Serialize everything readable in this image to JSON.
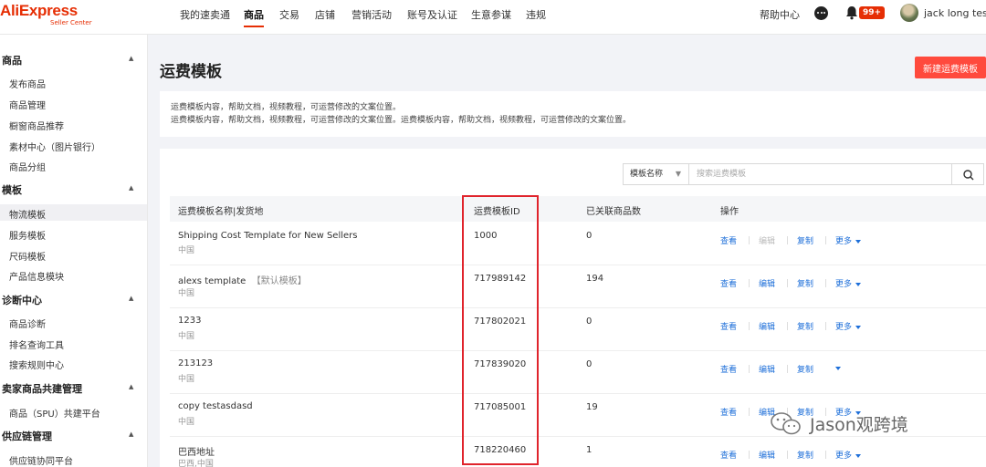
{
  "brand": {
    "logo_text": "AliExpress",
    "logo_sub": "Seller Center",
    "accent": "#e62e04"
  },
  "topnav": {
    "items": [
      "我的速卖通",
      "商品",
      "交易",
      "店铺",
      "营销活动",
      "账号及认证",
      "生意参谋",
      "违规"
    ],
    "active": "商品"
  },
  "header_right": {
    "help": "帮助中心",
    "badge": "99+",
    "user": "jack long test"
  },
  "sidebar": {
    "groups": [
      {
        "title": "商品",
        "items": [
          "发布商品",
          "商品管理",
          "橱窗商品推荐",
          "素材中心（图片银行）",
          "商品分组"
        ]
      },
      {
        "title": "模板",
        "items": [
          "物流模板",
          "服务模板",
          "尺码模板",
          "产品信息模块"
        ]
      },
      {
        "title": "诊断中心",
        "items": [
          "商品诊断",
          "排名查询工具",
          "搜索规则中心"
        ]
      },
      {
        "title": "卖家商品共建管理",
        "items": [
          "商品（SPU）共建平台"
        ]
      },
      {
        "title": "供应链管理",
        "items": [
          "供应链协同平台"
        ]
      }
    ],
    "active_item": "物流模板"
  },
  "page": {
    "title": "运费模板",
    "new_button": "新建运费模板",
    "notice_lines": [
      "运费模板内容，帮助文档，视频教程，可运营修改的文案位置。",
      "运费模板内容，帮助文档，视频教程，可运营修改的文案位置。运费模板内容，帮助文档，视频教程，可运营修改的文案位置。"
    ]
  },
  "search": {
    "select_value": "模板名称",
    "placeholder": "搜索运费模板"
  },
  "table": {
    "columns": [
      "运费模板名称|发货地",
      "运费模板ID",
      "已关联商品数",
      "操作"
    ],
    "rows": [
      {
        "name": "Shipping Cost Template for New Sellers",
        "tag": "",
        "origin": "中国",
        "id": "1000",
        "count": "0",
        "show_more": true
      },
      {
        "name": "alexs template",
        "tag": "【默认模板】",
        "origin": "中国",
        "id": "717989142",
        "count": "194",
        "show_more": true
      },
      {
        "name": "1233",
        "tag": "",
        "origin": "中国",
        "id": "717802021",
        "count": "0",
        "show_more": true
      },
      {
        "name": "213123",
        "tag": "",
        "origin": "中国",
        "id": "717839020",
        "count": "0",
        "show_more": false
      },
      {
        "name": "copy testasdasd",
        "tag": "",
        "origin": "中国",
        "id": "717085001",
        "count": "19",
        "show_more": true
      },
      {
        "name": "巴西地址",
        "tag": "",
        "origin": "巴西,中国",
        "id": "718220460",
        "count": "1",
        "show_more": true
      }
    ],
    "actions": {
      "view": "查看",
      "edit": "编辑",
      "copy": "复制",
      "more": "更多"
    }
  },
  "watermark": {
    "text": "Jason观跨境"
  },
  "colors": {
    "link": "#1e6fd9",
    "primary_button": "#ff4a3d",
    "highlight": "#e0242c"
  }
}
